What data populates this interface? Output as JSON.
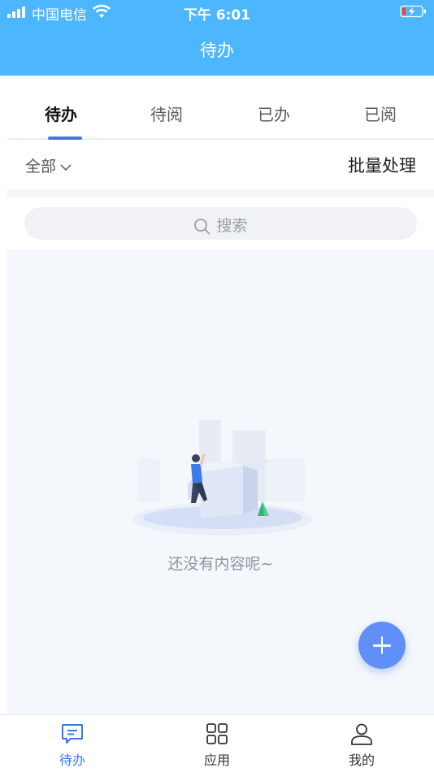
{
  "status_bar": {
    "carrier": "中国电信",
    "time": "下午 6:01"
  },
  "nav": {
    "title": "待办"
  },
  "tabs": [
    {
      "label": "待办",
      "active": true
    },
    {
      "label": "待阅",
      "active": false
    },
    {
      "label": "已办",
      "active": false
    },
    {
      "label": "已阅",
      "active": false
    }
  ],
  "filter": {
    "selected": "全部",
    "batch_label": "批量处理"
  },
  "search": {
    "placeholder": "搜索"
  },
  "empty_state": {
    "message": "还没有内容呢~"
  },
  "bottom_nav": [
    {
      "label": "待办",
      "icon": "message-square-icon",
      "active": true
    },
    {
      "label": "应用",
      "icon": "apps-grid-icon",
      "active": false
    },
    {
      "label": "我的",
      "icon": "user-icon",
      "active": false
    }
  ],
  "colors": {
    "header": "#4cb6ff",
    "accent": "#3f78e8",
    "fab": "#5f8ff7",
    "battery_low": "#ff3b30"
  }
}
